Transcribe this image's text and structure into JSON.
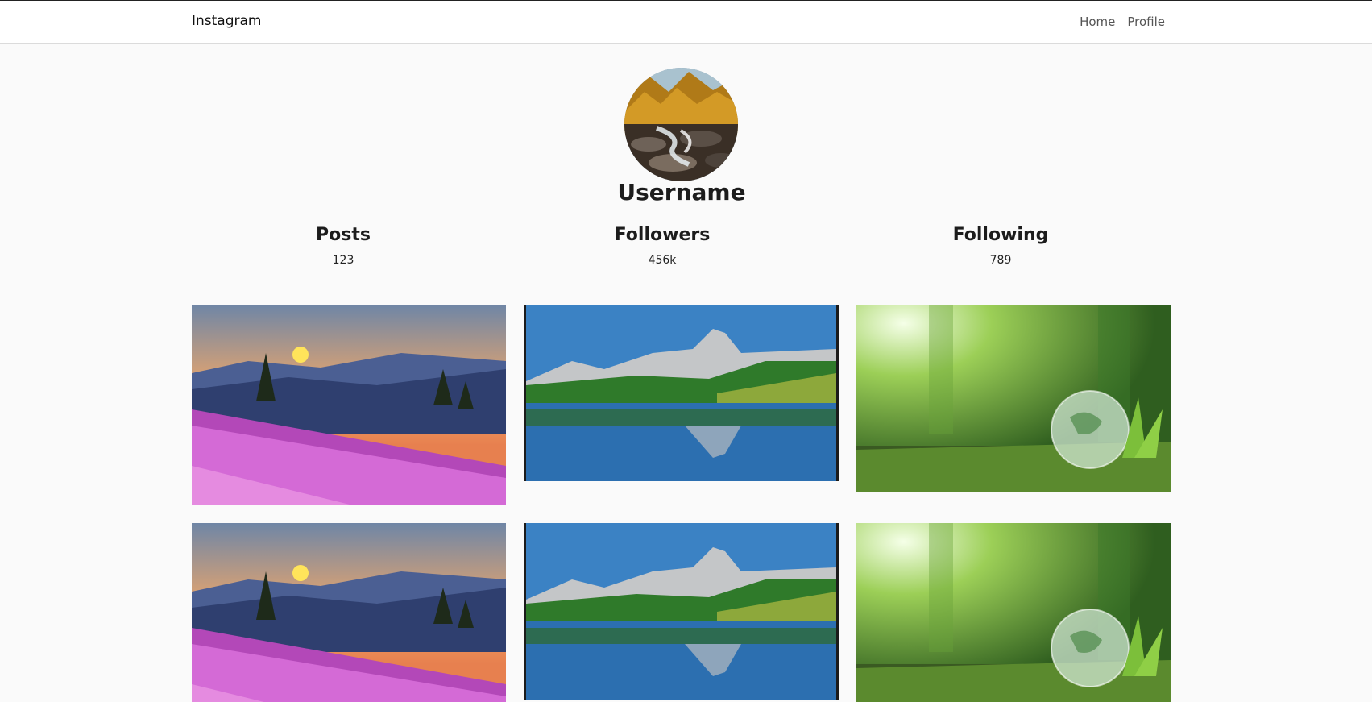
{
  "nav": {
    "brand": "Instagram",
    "links": [
      {
        "label": "Home"
      },
      {
        "label": "Profile"
      }
    ]
  },
  "profile": {
    "username": "Username",
    "avatar_alt": "forest stream avatar"
  },
  "stats": [
    {
      "label": "Posts",
      "value": "123"
    },
    {
      "label": "Followers",
      "value": "456k"
    },
    {
      "label": "Following",
      "value": "789"
    }
  ],
  "posts": [
    {
      "scene": "flower-meadow-sunset"
    },
    {
      "scene": "mountain-lake-reflection"
    },
    {
      "scene": "forest-glass-globe"
    },
    {
      "scene": "flower-meadow-sunset"
    },
    {
      "scene": "mountain-lake-reflection"
    },
    {
      "scene": "forest-glass-globe"
    }
  ],
  "colors": {
    "background": "#fafafa",
    "navbar": "#ffffff",
    "border": "#dbdbdb"
  }
}
